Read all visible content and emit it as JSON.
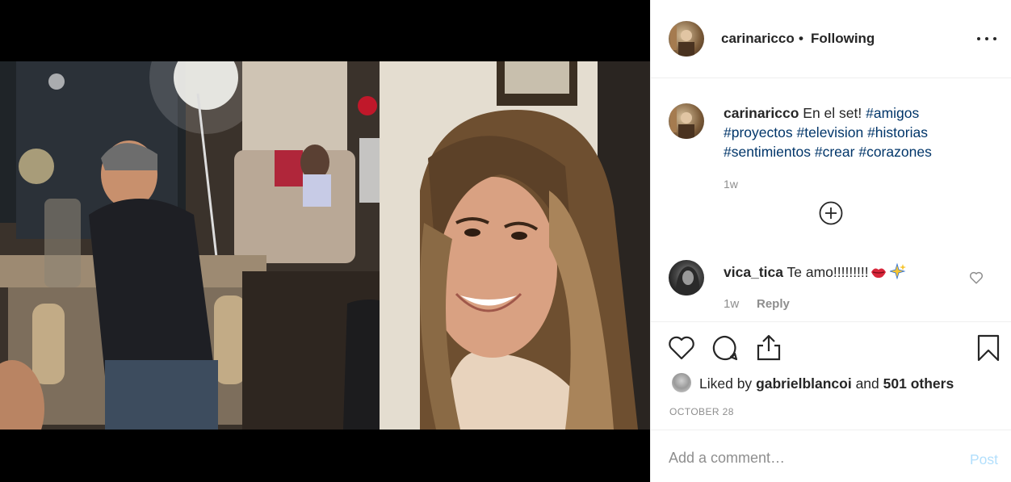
{
  "post": {
    "username": "carinaricco",
    "separator": "•",
    "follow_status": "Following",
    "more_icon": "more-horizontal-icon"
  },
  "caption": {
    "username": "carinaricco",
    "text": "En el set!",
    "hashtags": [
      "#amigos",
      "#proyectos",
      "#television",
      "#historias",
      "#sentimientos",
      "#crear",
      "#corazones"
    ],
    "time": "1w"
  },
  "load_more_icon": "plus-circle-icon",
  "comments": [
    {
      "username": "vica_tica",
      "text": "Te amo!!!!!!!!!",
      "emojis": [
        "lips-icon",
        "sparkles-icon"
      ],
      "time": "1w",
      "reply_label": "Reply"
    }
  ],
  "actions": {
    "like_icon": "heart-icon",
    "comment_icon": "comment-icon",
    "share_icon": "share-icon",
    "save_icon": "bookmark-icon"
  },
  "likes": {
    "prefix": "Liked by",
    "user": "gabrielblancoi",
    "conj": "and",
    "others": "501 others"
  },
  "date": "OCTOBER 28",
  "add_comment": {
    "placeholder": "Add a comment…",
    "post_label": "Post"
  },
  "colors": {
    "text": "#262626",
    "hashtag": "#003569",
    "muted": "#8e8e8e",
    "post_disabled": "#b2dffc",
    "border": "#efefef"
  }
}
